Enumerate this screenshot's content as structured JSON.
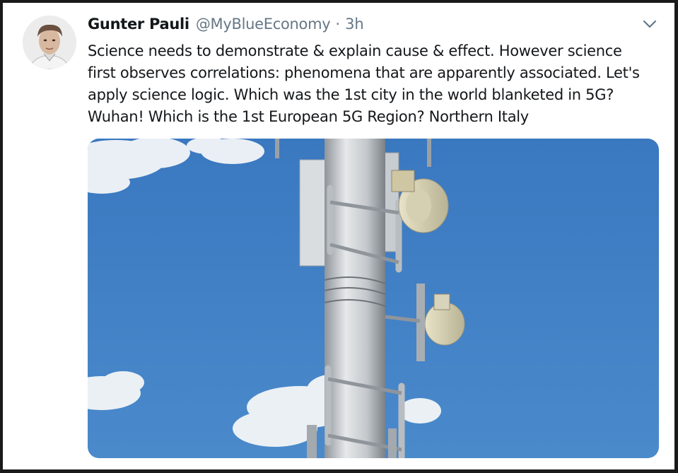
{
  "tweet": {
    "author_name": "Gunter Pauli",
    "handle": "@MyBlueEconomy",
    "separator": "·",
    "time": "3h",
    "text_lines": [
      "Science needs to demonstrate & explain cause & effect. However science",
      "first observes correlations: phenomena that are apparently associated. Let's",
      "apply science logic. Which was the 1st city in the world blanketed in 5G?",
      "Wuhan! Which is the 1st European 5G Region? Northern Italy"
    ],
    "menu_icon": "chevron-down-icon",
    "avatar_icon": "avatar",
    "media": "cell-tower-photo"
  },
  "colors": {
    "text": "#14171a",
    "secondary": "#657786",
    "sky": "#3f7fc4"
  }
}
